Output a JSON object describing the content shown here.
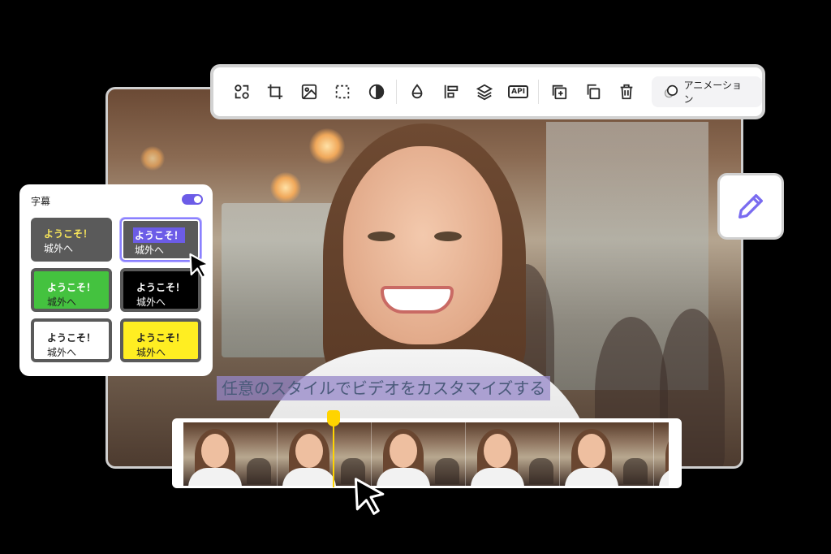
{
  "toolbar": {
    "tools": [
      "shapes-icon",
      "crop-icon",
      "image-icon",
      "select-icon",
      "contrast-icon",
      "color-drop-icon",
      "align-icon",
      "layers-icon",
      "api-icon",
      "add-copy-icon",
      "duplicate-icon",
      "delete-icon"
    ],
    "api_label": "API",
    "animation_label": "アニメーション"
  },
  "subtitle_panel": {
    "title": "字幕",
    "toggle_on": true,
    "styles": [
      {
        "line1": "ようこそ！",
        "line2": "城外へ",
        "bg": "#5a5a5a",
        "line1_color": "#f5e35a",
        "line2_color": "#ffffff",
        "line1_bg": ""
      },
      {
        "line1": "ようこそ！",
        "line2": "城外へ",
        "bg": "#5a5a5a",
        "line1_color": "#ffffff",
        "line2_color": "#ffffff",
        "line1_bg": "#6c5ce7",
        "selected": true
      },
      {
        "line1": "ようこそ！",
        "line2": "城外へ",
        "bg": "#44c23f",
        "line1_color": "#ffffff",
        "line2_color": "#222222",
        "line1_bg": ""
      },
      {
        "line1": "ようこそ！",
        "line2": "城外へ",
        "bg": "#000000",
        "line1_color": "#ffffff",
        "line2_color": "#ffffff",
        "line1_bg": ""
      },
      {
        "line1": "ようこそ！",
        "line2": "城外へ",
        "bg": "#ffffff",
        "line1_color": "#222222",
        "line2_color": "#222222",
        "line1_bg": ""
      },
      {
        "line1": "ようこそ！",
        "line2": "城外へ",
        "bg": "#ffee22",
        "line1_color": "#222222",
        "line2_color": "#222222",
        "line1_bg": ""
      }
    ]
  },
  "caption": {
    "text": "任意のスタイルでビデオをカスタマイズする"
  },
  "timeline": {
    "thumbnail_count": 6,
    "playhead_color": "#ffd400"
  },
  "colors": {
    "accent": "#6c5ce7",
    "pencil": "#7a6cf0"
  }
}
